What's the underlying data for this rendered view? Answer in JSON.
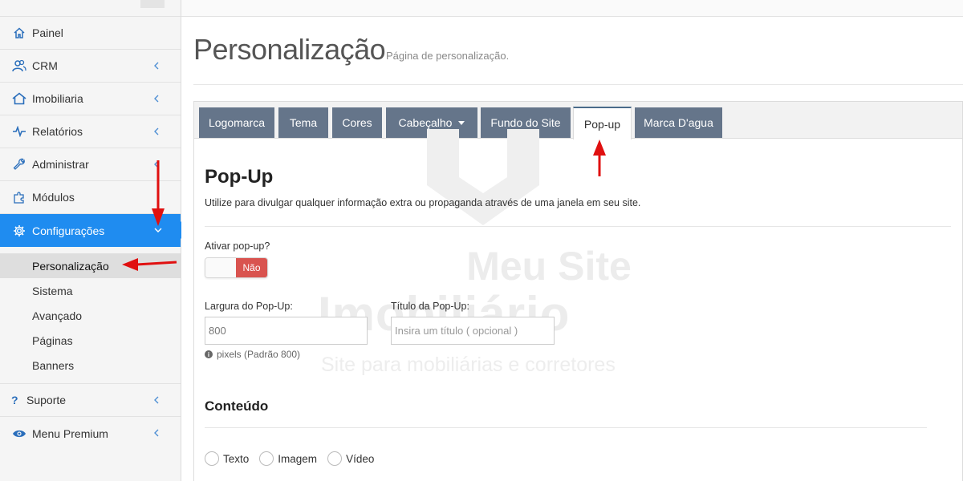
{
  "sidebar": {
    "items": [
      {
        "label": "Painel",
        "icon": "home-icon",
        "has_chevron": false
      },
      {
        "label": "CRM",
        "icon": "users-icon",
        "has_chevron": true
      },
      {
        "label": "Imobiliaria",
        "icon": "house-icon",
        "has_chevron": true
      },
      {
        "label": "Relatórios",
        "icon": "pulse-icon",
        "has_chevron": true
      },
      {
        "label": "Administrar",
        "icon": "wrench-icon",
        "has_chevron": true
      },
      {
        "label": "Módulos",
        "icon": "puzzle-icon",
        "has_chevron": false
      },
      {
        "label": "Configurações",
        "icon": "gear-icon",
        "has_chevron": true,
        "active": true
      }
    ],
    "submenu": [
      {
        "label": "Personalização",
        "current": true
      },
      {
        "label": "Sistema"
      },
      {
        "label": "Avançado"
      },
      {
        "label": "Páginas"
      },
      {
        "label": "Banners"
      }
    ],
    "bottom_items": [
      {
        "label": "Suporte",
        "icon": "question-icon"
      },
      {
        "label": "Menu Premium",
        "icon": "eye-icon"
      }
    ]
  },
  "page": {
    "title": "Personalização",
    "subtitle": "Página de personalização."
  },
  "tabs": [
    {
      "label": "Logomarca"
    },
    {
      "label": "Tema"
    },
    {
      "label": "Cores"
    },
    {
      "label": "Cabeçalho"
    },
    {
      "label": "Fundo do Site"
    },
    {
      "label": "Pop-up"
    },
    {
      "label": "Marca D'agua"
    }
  ],
  "active_tab": "Pop-up",
  "popup": {
    "title": "Pop-Up",
    "description": "Utilize para divulgar qualquer informação extra ou propaganda através de uma janela em seu site.",
    "enable_label": "Ativar pop-up?",
    "enable_value": "Não",
    "width_label": "Largura do Pop-Up:",
    "width_value": "800",
    "width_help": "pixels (Padrão 800)",
    "title_label": "Título da Pop-Up:",
    "title_placeholder": "Insira um título ( opcional )",
    "content_title": "Conteúdo",
    "content_options": [
      {
        "label": "Texto"
      },
      {
        "label": "Imagem"
      },
      {
        "label": "Vídeo"
      }
    ]
  },
  "watermark": {
    "line1": "Meu Site",
    "line2": "Imobiliário",
    "line3": "Site para mobiliárias e corretores"
  },
  "colors": {
    "accent": "#1f8cf0",
    "tab": "#65758a",
    "danger": "#d9534f",
    "annotation": "#e01010"
  }
}
